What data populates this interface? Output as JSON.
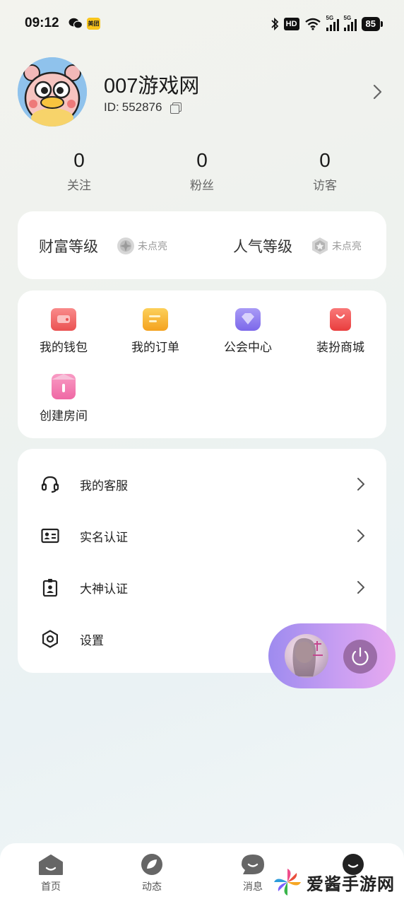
{
  "status_bar": {
    "time": "09:12",
    "meituan_label": "美团",
    "hd_label": "HD",
    "signal_tag": "5G",
    "battery": "85"
  },
  "profile": {
    "nickname": "007游戏网",
    "id_label": "ID:",
    "id_value": "552876"
  },
  "stats": [
    {
      "value": "0",
      "label": "关注"
    },
    {
      "value": "0",
      "label": "粉丝"
    },
    {
      "value": "0",
      "label": "访客"
    }
  ],
  "levels": {
    "wealth": {
      "title": "财富等级",
      "state": "未点亮"
    },
    "popularity": {
      "title": "人气等级",
      "state": "未点亮"
    }
  },
  "functions": [
    {
      "label": "我的钱包",
      "icon": "wallet-icon",
      "color": "#f06a6a"
    },
    {
      "label": "我的订单",
      "icon": "order-icon",
      "color": "#f7b12a"
    },
    {
      "label": "公会中心",
      "icon": "guild-icon",
      "color": "#8f7ef0"
    },
    {
      "label": "装扮商城",
      "icon": "shop-bag-icon",
      "color": "#f25656"
    },
    {
      "label": "创建房间",
      "icon": "create-room-icon",
      "color": "#f47fb0"
    }
  ],
  "menu": [
    {
      "label": "我的客服",
      "icon": "headset-icon"
    },
    {
      "label": "实名认证",
      "icon": "id-card-icon"
    },
    {
      "label": "大神认证",
      "icon": "badge-icon"
    },
    {
      "label": "设置",
      "icon": "gear-icon"
    }
  ],
  "bottom_nav": [
    {
      "label": "首页",
      "icon": "home-icon"
    },
    {
      "label": "动态",
      "icon": "feed-icon"
    },
    {
      "label": "消息",
      "icon": "message-icon"
    },
    {
      "label": "",
      "icon": "profile-icon"
    }
  ],
  "watermark": {
    "text": "爱酱手游网"
  }
}
